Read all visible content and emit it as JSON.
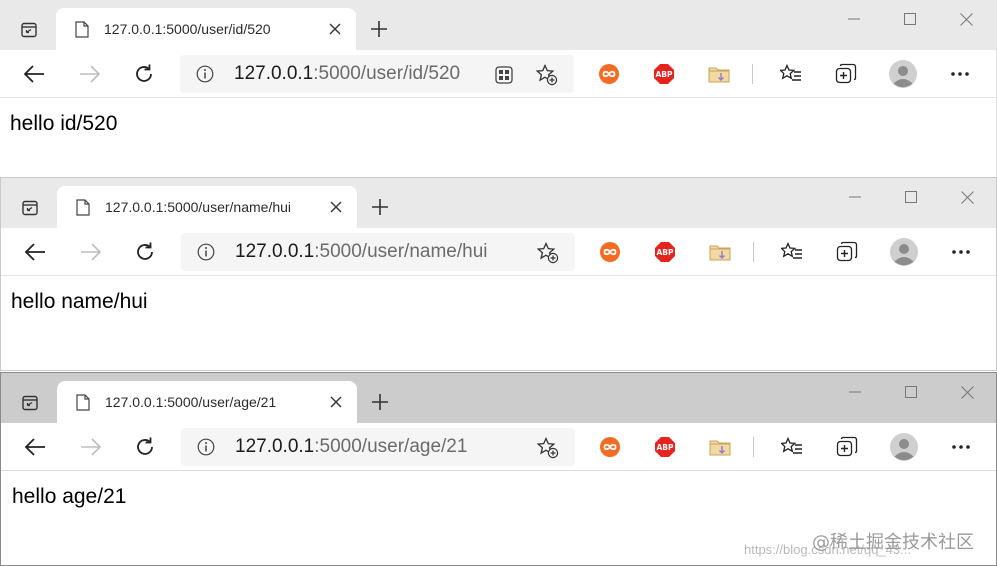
{
  "windows": [
    {
      "tab_title": "127.0.0.1:5000/user/id/520",
      "url_host": "127.0.0.1",
      "url_rest": ":5000/user/id/520",
      "page_text": "hello id/520",
      "show_apps_icon": true
    },
    {
      "tab_title": "127.0.0.1:5000/user/name/hui",
      "url_host": "127.0.0.1",
      "url_rest": ":5000/user/name/hui",
      "page_text": "hello name/hui",
      "show_apps_icon": false
    },
    {
      "tab_title": "127.0.0.1:5000/user/age/21",
      "url_host": "127.0.0.1",
      "url_rest": ":5000/user/age/21",
      "page_text": "hello age/21",
      "show_apps_icon": false
    }
  ],
  "extensions": {
    "abp_label": "ABP"
  },
  "icons": {
    "tab_actions": "tab-actions-icon",
    "page": "page-icon",
    "close": "close-icon",
    "new_tab": "plus-icon",
    "back": "back-arrow-icon",
    "forward": "forward-arrow-icon",
    "reload": "reload-icon",
    "info": "info-icon",
    "apps": "apps-icon",
    "add_favorite": "star-add-icon",
    "extension_infinity": "infinity-extension-icon",
    "extension_abp": "adblock-plus-icon",
    "extension_folder": "folder-download-icon",
    "favorites": "favorites-icon",
    "collections": "collections-icon",
    "profile": "profile-avatar-icon",
    "more": "more-menu-icon"
  },
  "colors": {
    "titlebar": "#e9e9e9",
    "titlebar_active": "#cccccc",
    "abp_red": "#e4241d",
    "infinity_orange": "#f36c24"
  },
  "watermark": {
    "logo": "@稀土掘金技术社区",
    "url": "https://blog.csdn.net/qq_43..."
  }
}
